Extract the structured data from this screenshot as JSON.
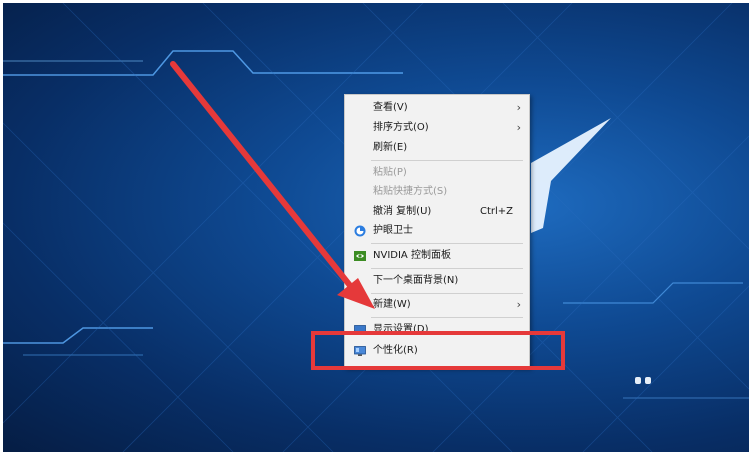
{
  "context_menu": {
    "items": [
      {
        "label": "查看(V)",
        "submenu": true,
        "disabled": false
      },
      {
        "label": "排序方式(O)",
        "submenu": true,
        "disabled": false
      },
      {
        "label": "刷新(E)",
        "submenu": false,
        "disabled": false
      },
      {
        "label": "粘贴(P)",
        "submenu": false,
        "disabled": true
      },
      {
        "label": "粘贴快捷方式(S)",
        "submenu": false,
        "disabled": true
      },
      {
        "label": "撤消 复制(U)",
        "shortcut": "Ctrl+Z",
        "submenu": false,
        "disabled": false
      },
      {
        "label": "护眼卫士",
        "icon": "eye-shield-icon",
        "submenu": false,
        "disabled": false
      },
      {
        "label": "NVIDIA 控制面板",
        "icon": "nvidia-icon",
        "submenu": false,
        "disabled": false
      },
      {
        "label": "下一个桌面背景(N)",
        "submenu": false,
        "disabled": false
      },
      {
        "label": "新建(W)",
        "submenu": true,
        "disabled": false
      },
      {
        "label": "显示设置(D)",
        "icon": "display-icon",
        "submenu": false,
        "disabled": false
      },
      {
        "label": "个性化(R)",
        "icon": "personalize-icon",
        "submenu": false,
        "disabled": false
      }
    ]
  },
  "colors": {
    "desktop_blue": "#0f4a93",
    "annotation_red": "#e5393a",
    "menu_bg": "#f2f2f2"
  }
}
